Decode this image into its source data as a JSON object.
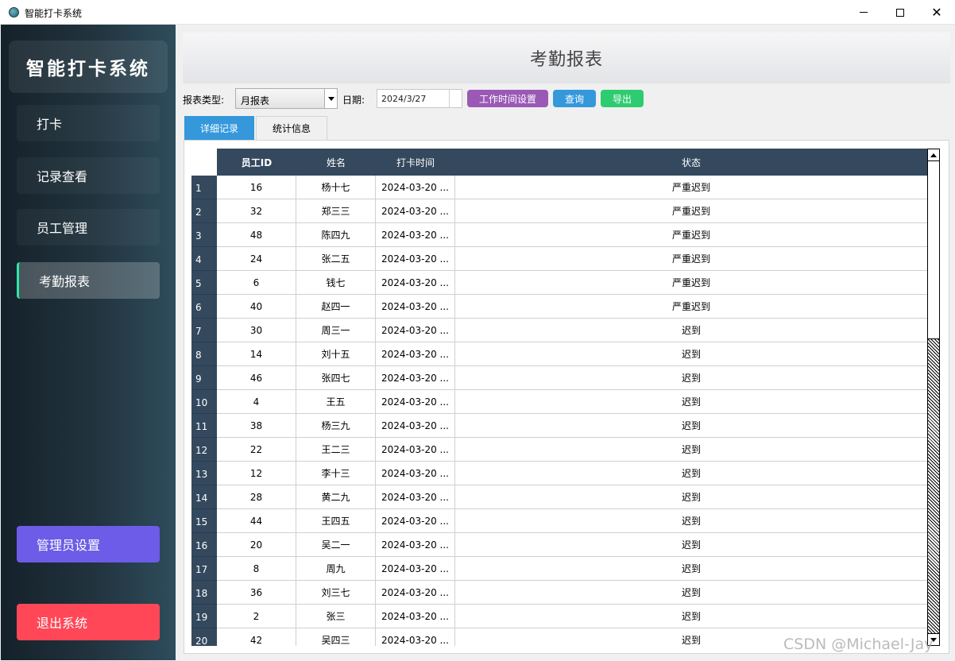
{
  "window": {
    "title": "智能打卡系统",
    "min_icon": "minimize-icon",
    "max_icon": "maximize-icon",
    "close_glyph": "✕"
  },
  "sidebar": {
    "logo": "智能打卡系统",
    "items": [
      {
        "label": "打卡",
        "active": false
      },
      {
        "label": "记录查看",
        "active": false
      },
      {
        "label": "员工管理",
        "active": false
      },
      {
        "label": "考勤报表",
        "active": true
      }
    ],
    "admin_label": "管理员设置",
    "exit_label": "退出系统",
    "colors": {
      "active_indicator": "#2ee6a8",
      "admin": "#6c5ce7",
      "exit": "#ff4757"
    }
  },
  "header": {
    "title": "考勤报表"
  },
  "toolbar": {
    "type_label": "报表类型:",
    "type_value": "月报表",
    "date_label": "日期:",
    "date_value": "2024/3/27",
    "worktime_button": "工作时间设置",
    "query_button": "查询",
    "export_button": "导出",
    "colors": {
      "worktime": "#9b59b6",
      "query": "#3498db",
      "export": "#2ecc71"
    }
  },
  "tabs": [
    {
      "label": "详细记录",
      "active": true
    },
    {
      "label": "统计信息",
      "active": false
    }
  ],
  "table": {
    "columns": [
      "员工ID",
      "姓名",
      "打卡时间",
      "状态"
    ],
    "rows": [
      {
        "num": "1",
        "id": "16",
        "name": "杨十七",
        "time": "2024-03-20 ...",
        "status": "严重迟到"
      },
      {
        "num": "2",
        "id": "32",
        "name": "郑三三",
        "time": "2024-03-20 ...",
        "status": "严重迟到"
      },
      {
        "num": "3",
        "id": "48",
        "name": "陈四九",
        "time": "2024-03-20 ...",
        "status": "严重迟到"
      },
      {
        "num": "4",
        "id": "24",
        "name": "张二五",
        "time": "2024-03-20 ...",
        "status": "严重迟到"
      },
      {
        "num": "5",
        "id": "6",
        "name": "钱七",
        "time": "2024-03-20 ...",
        "status": "严重迟到"
      },
      {
        "num": "6",
        "id": "40",
        "name": "赵四一",
        "time": "2024-03-20 ...",
        "status": "严重迟到"
      },
      {
        "num": "7",
        "id": "30",
        "name": "周三一",
        "time": "2024-03-20 ...",
        "status": "迟到"
      },
      {
        "num": "8",
        "id": "14",
        "name": "刘十五",
        "time": "2024-03-20 ...",
        "status": "迟到"
      },
      {
        "num": "9",
        "id": "46",
        "name": "张四七",
        "time": "2024-03-20 ...",
        "status": "迟到"
      },
      {
        "num": "10",
        "id": "4",
        "name": "王五",
        "time": "2024-03-20 ...",
        "status": "迟到"
      },
      {
        "num": "11",
        "id": "38",
        "name": "杨三九",
        "time": "2024-03-20 ...",
        "status": "迟到"
      },
      {
        "num": "12",
        "id": "22",
        "name": "王二三",
        "time": "2024-03-20 ...",
        "status": "迟到"
      },
      {
        "num": "13",
        "id": "12",
        "name": "李十三",
        "time": "2024-03-20 ...",
        "status": "迟到"
      },
      {
        "num": "14",
        "id": "28",
        "name": "黄二九",
        "time": "2024-03-20 ...",
        "status": "迟到"
      },
      {
        "num": "15",
        "id": "44",
        "name": "王四五",
        "time": "2024-03-20 ...",
        "status": "迟到"
      },
      {
        "num": "16",
        "id": "20",
        "name": "吴二一",
        "time": "2024-03-20 ...",
        "status": "迟到"
      },
      {
        "num": "17",
        "id": "8",
        "name": "周九",
        "time": "2024-03-20 ...",
        "status": "迟到"
      },
      {
        "num": "18",
        "id": "36",
        "name": "刘三七",
        "time": "2024-03-20 ...",
        "status": "迟到"
      },
      {
        "num": "19",
        "id": "2",
        "name": "张三",
        "time": "2024-03-20 ...",
        "status": "迟到"
      },
      {
        "num": "20",
        "id": "42",
        "name": "吴四三",
        "time": "2024-03-20 ...",
        "status": "迟到"
      }
    ]
  },
  "watermark": "CSDN @Michael-Jay"
}
